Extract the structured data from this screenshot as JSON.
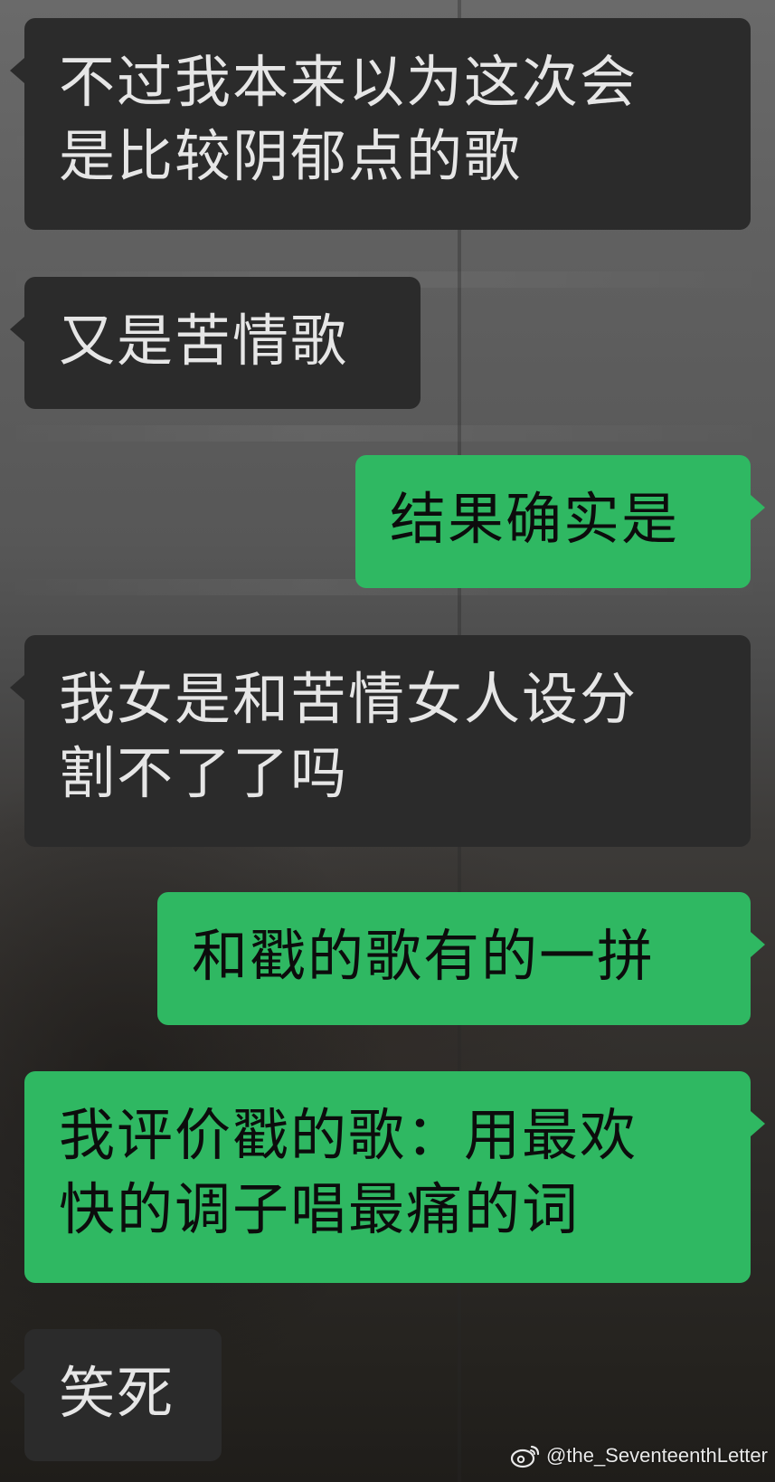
{
  "chat": {
    "messages": [
      {
        "side": "in",
        "text": "不过我本来以为这次会\n是比较阴郁点的歌"
      },
      {
        "side": "in",
        "text": "又是苦情歌"
      },
      {
        "side": "out",
        "text": "结果确实是"
      },
      {
        "side": "in",
        "text": "我女是和苦情女人设分\n割不了了吗"
      },
      {
        "side": "out",
        "text": "和戳的歌有的一拼"
      },
      {
        "side": "out",
        "text": "我评价戳的歌：用最欢\n快的调子唱最痛的词"
      },
      {
        "side": "in",
        "text": "笑死"
      }
    ]
  },
  "watermark": {
    "icon": "weibo-icon",
    "text": "@the_SeventeenthLetter"
  },
  "colors": {
    "incoming_bubble": "#2b2b2b",
    "outgoing_bubble": "#2fb862"
  }
}
